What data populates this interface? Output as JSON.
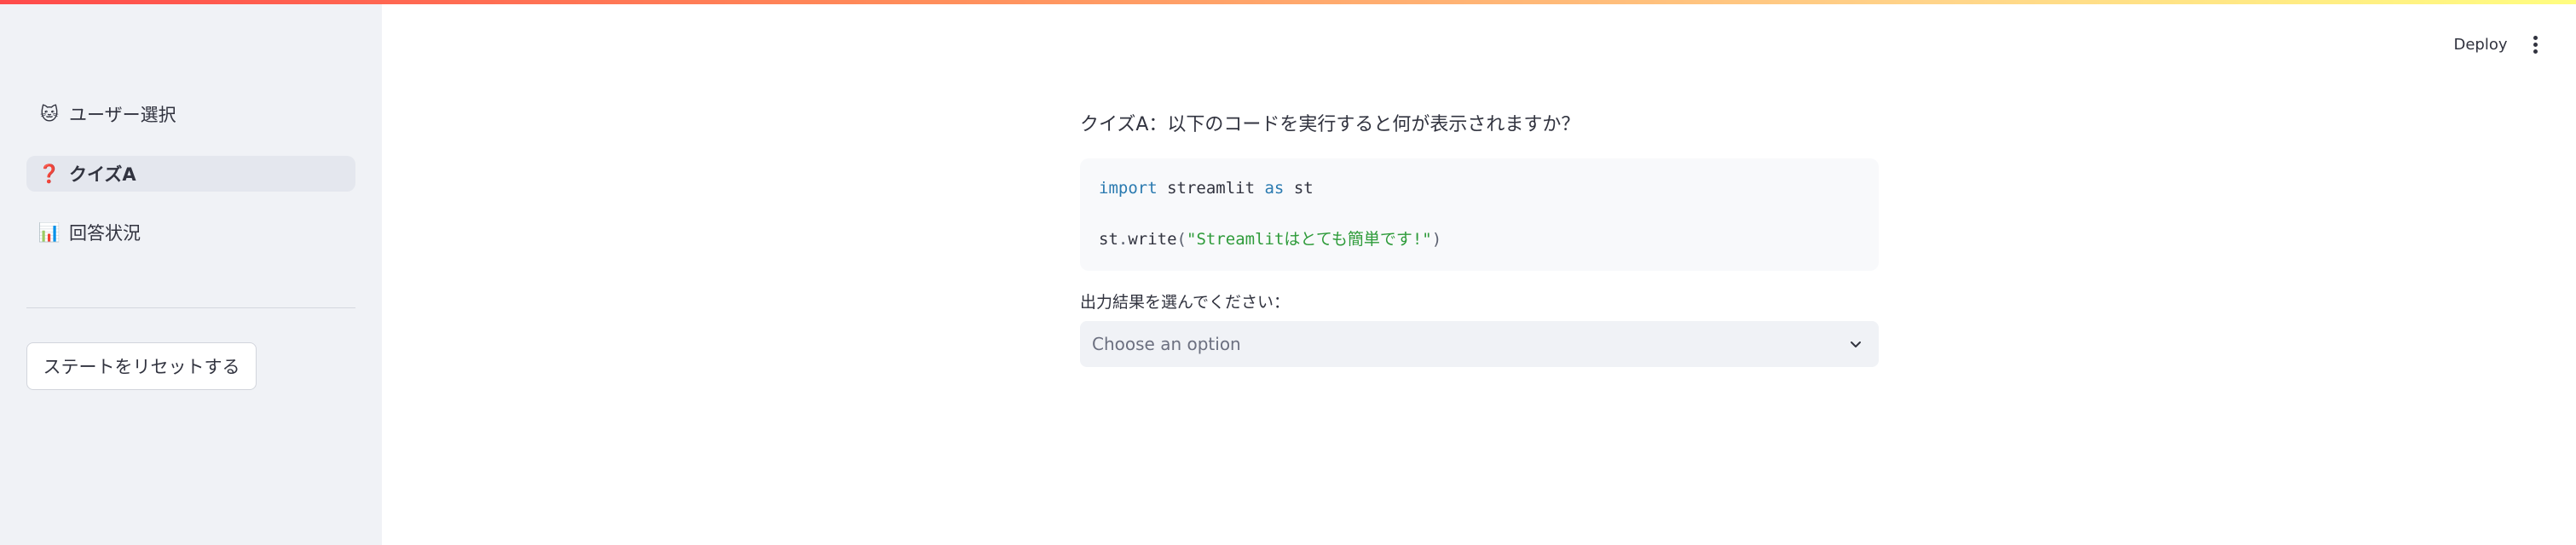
{
  "sidebar": {
    "items": [
      {
        "icon": "cat-face-icon",
        "glyph": "🐱",
        "label": "ユーザー選択",
        "active": false
      },
      {
        "icon": "question-mark-icon",
        "glyph": "❓",
        "label": "クイズA",
        "active": true
      },
      {
        "icon": "bar-chart-icon",
        "glyph": "📊",
        "label": "回答状況",
        "active": false
      }
    ],
    "reset_button_label": "ステートをリセットする"
  },
  "header": {
    "deploy_label": "Deploy",
    "menu_icon": "vertical-ellipsis-icon"
  },
  "main": {
    "question": "クイズA：以下のコードを実行すると何が表示されますか？",
    "code": {
      "line1_keyword_import": "import",
      "line1_module": " streamlit ",
      "line1_keyword_as": "as",
      "line1_alias": " st",
      "line2_obj": "st",
      "line2_dot": ".",
      "line2_method": "write",
      "line2_paren_open": "(",
      "line2_string": "\"Streamlitはとても簡単です!\"",
      "line2_paren_close": ")"
    },
    "select": {
      "label": "出力結果を選んでください：",
      "placeholder": "Choose an option"
    }
  },
  "colors": {
    "sidebar_bg": "#f0f2f6",
    "active_item_bg": "#e4e7ee",
    "keyword": "#2a7ab0",
    "string": "#2e9b3a",
    "text": "#31333f",
    "accent_gradient_start": "#ff4b4b"
  }
}
